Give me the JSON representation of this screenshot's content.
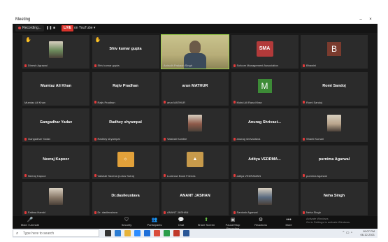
{
  "window": {
    "title": "Meeting",
    "minimize": "–",
    "close": "×"
  },
  "recording_bar": {
    "recording_label": "Recording...",
    "pause_symbol": "❚❚",
    "stop_symbol": "■",
    "live_label": "LIVE",
    "live_platform": "on YouTube ▾"
  },
  "participants": [
    {
      "tile_name": "",
      "label": "Dinesh Agrawal",
      "muted": true,
      "hand": true,
      "visual": "photo",
      "color": "#6c8a5c"
    },
    {
      "tile_name": "Shiv kumar gupta",
      "label": "Shiv kumar gupta",
      "muted": true,
      "hand": true,
      "visual": "name",
      "color": ""
    },
    {
      "tile_name": "",
      "label": "Anirudh Prakash Singh",
      "muted": false,
      "hand": false,
      "visual": "video",
      "color": "#c9c38d",
      "speaking": true
    },
    {
      "tile_name": "",
      "label": "Sofcom Management Association",
      "muted": true,
      "hand": false,
      "visual": "logo",
      "color": "#b23a3a",
      "logo_text": "SMA"
    },
    {
      "tile_name": "",
      "label": "Bhawini",
      "muted": true,
      "hand": false,
      "visual": "avatar",
      "color": "#7a3b2e",
      "initial": "B"
    },
    {
      "tile_name": "Mumtaz Ali Khan",
      "label": "Mumtaz Ali Khan",
      "muted": false,
      "hand": false,
      "visual": "name",
      "color": ""
    },
    {
      "tile_name": "Rajiv Pradhan",
      "label": "Rajiv Pradhan",
      "muted": true,
      "hand": false,
      "visual": "name",
      "color": ""
    },
    {
      "tile_name": "arun MATHUR",
      "label": "arun MATHUR",
      "muted": true,
      "hand": false,
      "visual": "name",
      "color": ""
    },
    {
      "tile_name": "",
      "label": "Mohd Ali Raza Khan",
      "muted": true,
      "hand": false,
      "visual": "avatar",
      "color": "#3d8b37",
      "initial": "M"
    },
    {
      "tile_name": "Romi Sandoj",
      "label": "Romi Sandoj",
      "muted": true,
      "hand": false,
      "visual": "name",
      "color": ""
    },
    {
      "tile_name": "Gangadhar Yadav",
      "label": "Gangadhar Yadav",
      "muted": true,
      "hand": false,
      "visual": "name",
      "color": ""
    },
    {
      "tile_name": "Radhey shyampal",
      "label": "Radhey shyampal",
      "muted": true,
      "hand": false,
      "visual": "name",
      "color": ""
    },
    {
      "tile_name": "",
      "label": "Vaishali Kamble",
      "muted": true,
      "hand": false,
      "visual": "photo",
      "color": "#8e5a4a"
    },
    {
      "tile_name": "Anurag Shrivast...",
      "label": "anurag shrivastava",
      "muted": true,
      "hand": false,
      "visual": "name",
      "color": ""
    },
    {
      "tile_name": "",
      "label": "Shanti Kumari",
      "muted": true,
      "hand": false,
      "visual": "photo",
      "color": "#b9a58c"
    },
    {
      "tile_name": "Neeraj Kapoor",
      "label": "Neeraj Kapoor",
      "muted": true,
      "hand": false,
      "visual": "name",
      "color": ""
    },
    {
      "tile_name": "",
      "label": "Vaishali Saxena (Lotus Sutra)",
      "muted": true,
      "hand": false,
      "visual": "logo",
      "color": "#e2a13a",
      "logo_text": "☼"
    },
    {
      "tile_name": "",
      "label": "Lucknow Book Friends",
      "muted": true,
      "hand": false,
      "visual": "logo",
      "color": "#c79a4b",
      "logo_text": "▲"
    },
    {
      "tile_name": "Aditya VEDRMA...",
      "label": "aditya VEDRAMAN",
      "muted": true,
      "hand": false,
      "visual": "name",
      "color": ""
    },
    {
      "tile_name": "purnima Agarwal",
      "label": "purnima Agarwal",
      "muted": true,
      "hand": false,
      "visual": "name",
      "color": ""
    },
    {
      "tile_name": "",
      "label": "Fatima Hamid",
      "muted": true,
      "hand": false,
      "visual": "photo",
      "color": "#8a7a6a"
    },
    {
      "tile_name": "Dr.dasileustava",
      "label": "Dr. dasileustava",
      "muted": true,
      "hand": false,
      "visual": "name",
      "color": ""
    },
    {
      "tile_name": "ANANT JASHAN",
      "label": "ANANT JASHAN",
      "muted": true,
      "hand": false,
      "visual": "name",
      "color": ""
    },
    {
      "tile_name": "",
      "label": "Santosh Agarwal",
      "muted": true,
      "hand": false,
      "visual": "photo",
      "color": "#5a6b80"
    },
    {
      "tile_name": "Neha Singh",
      "label": "Neha Singh",
      "muted": true,
      "hand": false,
      "visual": "name",
      "color": ""
    }
  ],
  "toolbar": [
    {
      "icon": "🎤",
      "label": "Mute / Unmute"
    },
    {
      "icon": "⛉",
      "label": "Security"
    },
    {
      "icon": "👥",
      "label": "Participants"
    },
    {
      "icon": "💬",
      "label": "Chat"
    },
    {
      "icon": "⬆",
      "label": "Share Screen",
      "green": true
    },
    {
      "icon": "▣",
      "label": "Pause/Stop Recording"
    },
    {
      "icon": "⚙",
      "label": "Reactions"
    },
    {
      "icon": "•••",
      "label": "More"
    }
  ],
  "taskbar": {
    "search_placeholder": "Type here to search",
    "time": "10:07 PM",
    "date": "06-12-2021"
  },
  "watermark": {
    "line1": "Activate Windows",
    "line2": "Go to Settings to activate Windows."
  }
}
